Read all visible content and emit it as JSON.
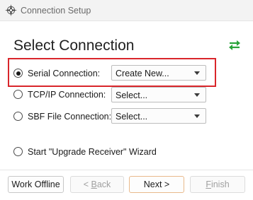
{
  "window": {
    "title": "Connection Setup"
  },
  "icons": {
    "app": "compass-rose-icon",
    "swap": "swap-arrows-icon",
    "swap_color": "#2aa33a"
  },
  "main": {
    "heading": "Select Connection"
  },
  "options": [
    {
      "label": "Serial Connection:",
      "combo_value": "Create New...",
      "selected": true
    },
    {
      "label": "TCP/IP Connection:",
      "combo_value": "Select...",
      "selected": false
    },
    {
      "label": "SBF File Connection:",
      "combo_value": "Select...",
      "selected": false
    }
  ],
  "wizard": {
    "label": "Start \"Upgrade Receiver\" Wizard"
  },
  "buttons": {
    "work_offline": "Work Offline",
    "back_lt": "< ",
    "back_key": "B",
    "back_rest": "ack",
    "next": "Next >",
    "finish_key": "F",
    "finish_rest": "inish"
  },
  "colors": {
    "highlight": "#d9262b",
    "accent_border": "#e9b98b"
  }
}
